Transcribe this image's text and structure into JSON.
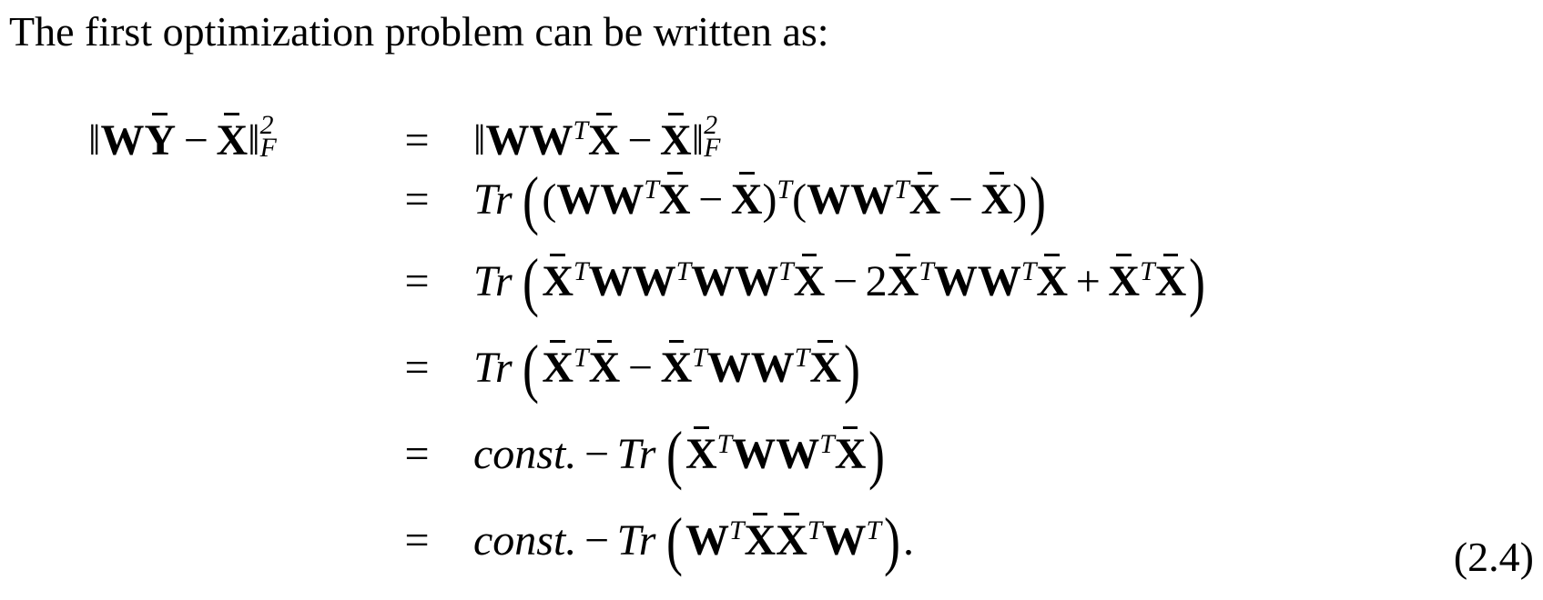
{
  "intro_text": "The first optimization problem can be written as:",
  "equation": {
    "eq_sign": "=",
    "number": "(2.4)",
    "row_count": 6
  }
}
